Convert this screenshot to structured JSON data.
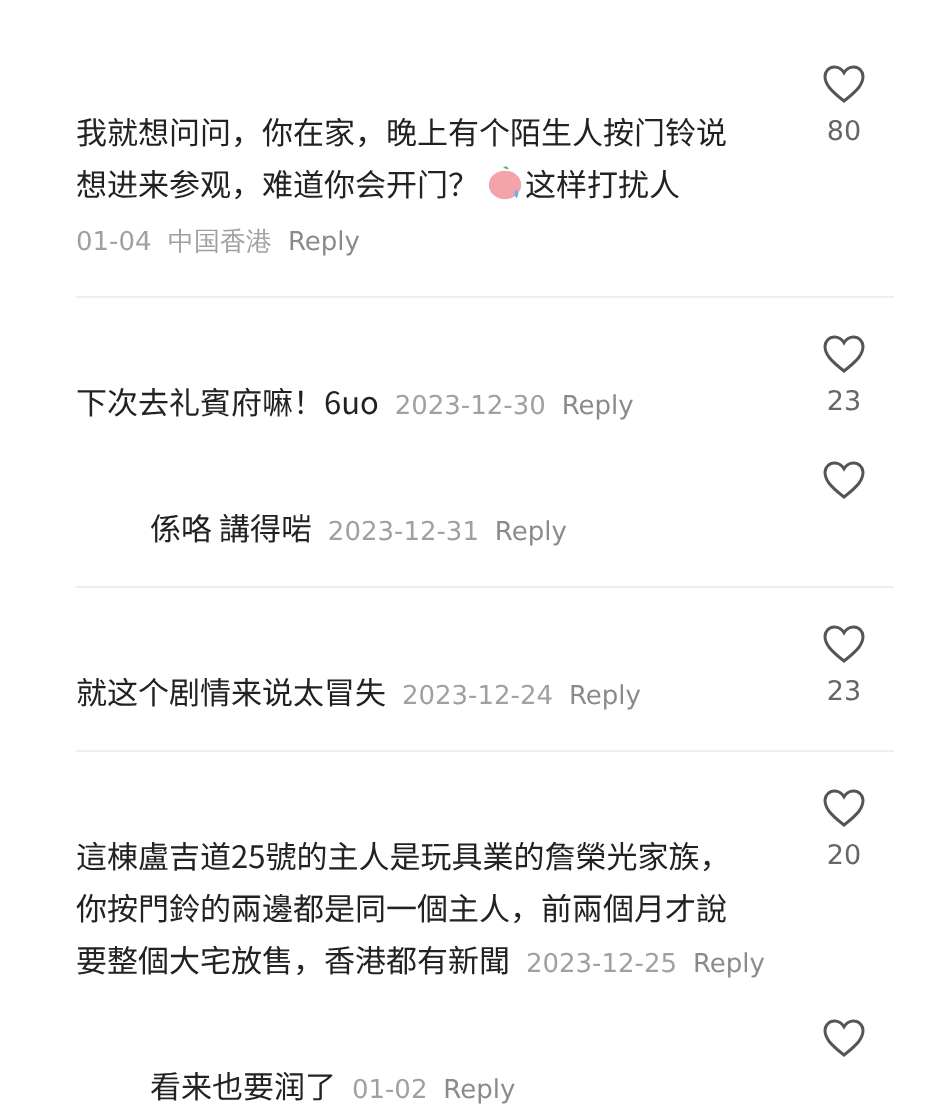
{
  "threads": [
    {
      "lines": [
        {
          "segments": [
            {
              "kind": "text",
              "text": "我就想问问，你在家，晚上有个陌生人按门铃说"
            }
          ]
        },
        {
          "segments": [
            {
              "kind": "text",
              "text": "想进来参观，难道你会开门？"
            },
            {
              "kind": "emoji"
            },
            {
              "kind": "text",
              "text": "这样打扰人"
            }
          ]
        }
      ],
      "date": "01-04",
      "location": "中国香港",
      "reply_label": "Reply",
      "meta_inline": false,
      "likes": "80",
      "liked": false
    },
    {
      "lines": [
        {
          "segments": [
            {
              "kind": "text",
              "text": "下次去礼賓府嘛！6uo"
            }
          ]
        }
      ],
      "date": "2023-12-30",
      "reply_label": "Reply",
      "meta_inline": true,
      "likes": "23",
      "liked": false,
      "children": [
        {
          "lines": [
            {
              "segments": [
                {
                  "kind": "text",
                  "text": "係咯 講得啱"
                }
              ]
            }
          ],
          "date": "2023-12-31",
          "reply_label": "Reply",
          "meta_inline": true,
          "liked": false
        }
      ]
    },
    {
      "lines": [
        {
          "segments": [
            {
              "kind": "text",
              "text": "就这个剧情来说太冒失"
            }
          ]
        }
      ],
      "date": "2023-12-24",
      "reply_label": "Reply",
      "meta_inline": true,
      "likes": "23",
      "liked": false
    },
    {
      "lines": [
        {
          "segments": [
            {
              "kind": "text",
              "text": "這棟盧吉道25號的主人是玩具業的詹榮光家族，"
            }
          ]
        },
        {
          "segments": [
            {
              "kind": "text",
              "text": "你按門鈴的兩邊都是同一個主人，前兩個月才說"
            }
          ]
        },
        {
          "segments": [
            {
              "kind": "text",
              "text": "要整個大宅放售，香港都有新聞"
            }
          ]
        }
      ],
      "date": "2023-12-25",
      "reply_label": "Reply",
      "meta_inline": true,
      "likes": "20",
      "liked": false,
      "children": [
        {
          "lines": [
            {
              "segments": [
                {
                  "kind": "text",
                  "text": "看来也要润了"
                }
              ]
            }
          ],
          "date": "01-02",
          "reply_label": "Reply",
          "meta_inline": true,
          "liked": false
        }
      ]
    }
  ]
}
